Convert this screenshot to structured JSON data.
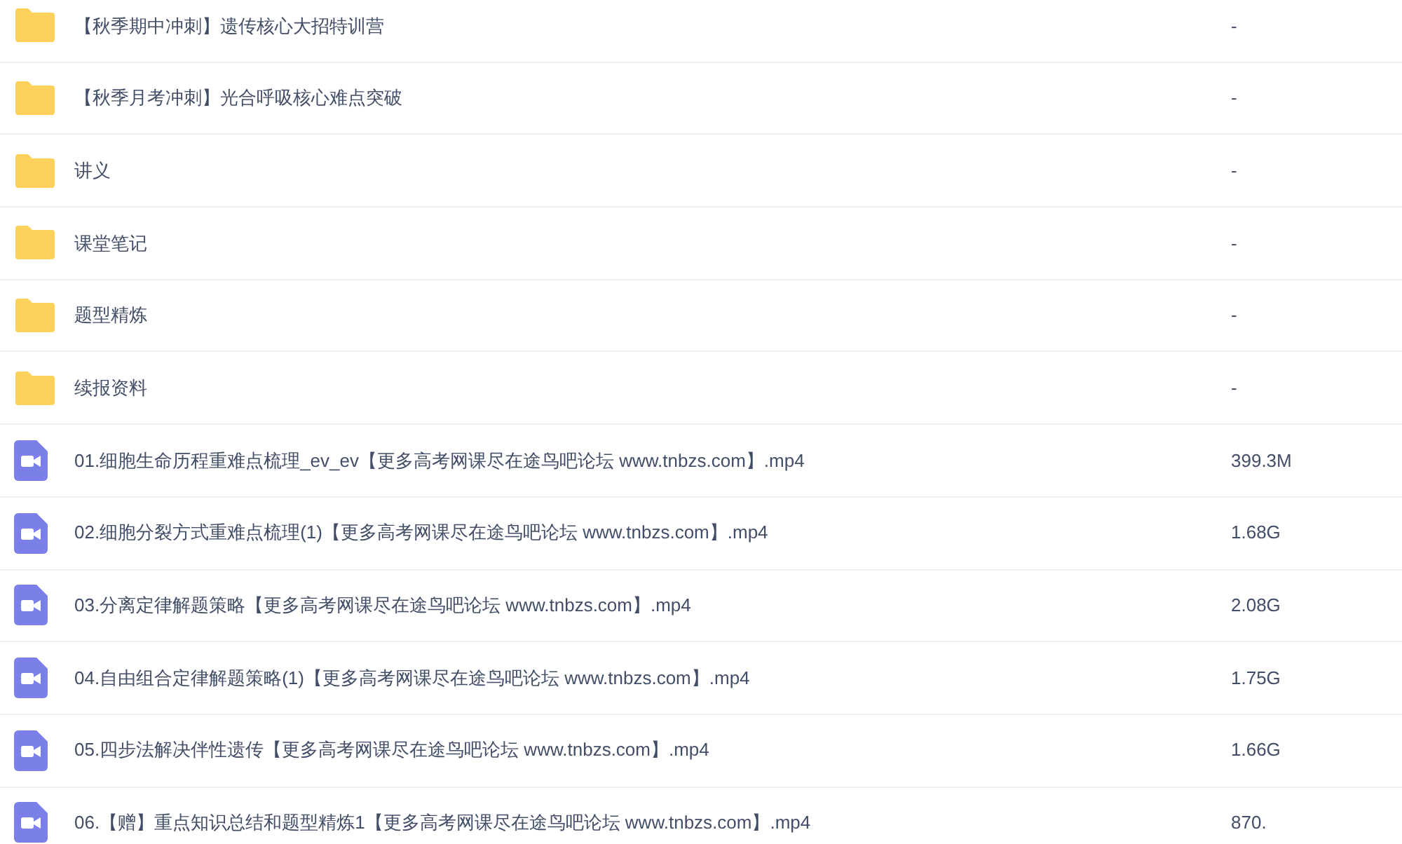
{
  "files": [
    {
      "kind": "folder",
      "name": "【秋季期中冲刺】遗传核心大招特训营",
      "size": "-"
    },
    {
      "kind": "folder",
      "name": "【秋季月考冲刺】光合呼吸核心难点突破",
      "size": "-"
    },
    {
      "kind": "folder",
      "name": "讲义",
      "size": "-"
    },
    {
      "kind": "folder",
      "name": "课堂笔记",
      "size": "-"
    },
    {
      "kind": "folder",
      "name": "题型精炼",
      "size": "-"
    },
    {
      "kind": "folder",
      "name": "续报资料",
      "size": "-"
    },
    {
      "kind": "video",
      "name": "01.细胞生命历程重难点梳理_ev_ev【更多高考网课尽在途鸟吧论坛 www.tnbzs.com】.mp4",
      "size": "399.3M"
    },
    {
      "kind": "video",
      "name": "02.细胞分裂方式重难点梳理(1)【更多高考网课尽在途鸟吧论坛 www.tnbzs.com】.mp4",
      "size": "1.68G"
    },
    {
      "kind": "video",
      "name": "03.分离定律解题策略【更多高考网课尽在途鸟吧论坛 www.tnbzs.com】.mp4",
      "size": "2.08G"
    },
    {
      "kind": "video",
      "name": "04.自由组合定律解题策略(1)【更多高考网课尽在途鸟吧论坛 www.tnbzs.com】.mp4",
      "size": "1.75G"
    },
    {
      "kind": "video",
      "name": "05.四步法解决伴性遗传【更多高考网课尽在途鸟吧论坛 www.tnbzs.com】.mp4",
      "size": "1.66G"
    },
    {
      "kind": "video",
      "name": "06.【赠】重点知识总结和题型精炼1【更多高考网课尽在途鸟吧论坛 www.tnbzs.com】.mp4",
      "size": "870."
    }
  ]
}
